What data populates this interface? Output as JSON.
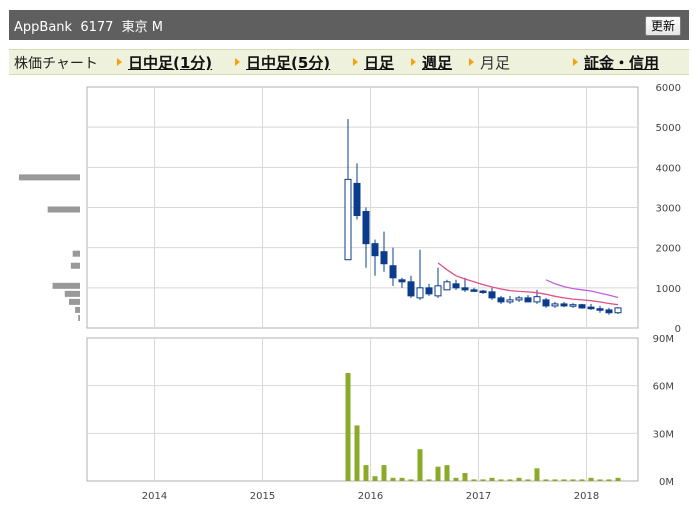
{
  "header": {
    "title": "AppBank  6177  東京 M",
    "refresh_label": "更新"
  },
  "nav": {
    "label": "株価チャート",
    "items": [
      {
        "label": "日中足(1分)",
        "current": false
      },
      {
        "label": "日中足(5分)",
        "current": false
      },
      {
        "label": "日足",
        "current": false
      },
      {
        "label": "週足",
        "current": false
      },
      {
        "label": "月足",
        "current": true
      },
      {
        "label": "証金・信用",
        "current": false
      }
    ]
  },
  "chart_data": [
    {
      "type": "candlestick",
      "title": "",
      "x_tick_labels": [
        "2014",
        "2015",
        "2016",
        "2017",
        "2018"
      ],
      "y_tick_labels": [
        "0",
        "1000",
        "2000",
        "3000",
        "4000",
        "5000",
        "6000"
      ],
      "ylim": [
        0,
        6000
      ],
      "grid": true,
      "colors": {
        "up": "#ffffff",
        "up_border": "#0b3c8c",
        "down": "#0b3c8c",
        "ma1": "#e0508a",
        "ma2": "#c060e0"
      },
      "candles": [
        {
          "date": "2015-10",
          "open": 1700,
          "high": 5200,
          "low": 1700,
          "close": 3700
        },
        {
          "date": "2015-11",
          "open": 3600,
          "high": 4100,
          "low": 2700,
          "close": 2800
        },
        {
          "date": "2015-12",
          "open": 2900,
          "high": 3000,
          "low": 1500,
          "close": 2100
        },
        {
          "date": "2016-01",
          "open": 2100,
          "high": 2200,
          "low": 1300,
          "close": 1800
        },
        {
          "date": "2016-02",
          "open": 1900,
          "high": 2400,
          "low": 1400,
          "close": 1600
        },
        {
          "date": "2016-03",
          "open": 1550,
          "high": 2000,
          "low": 1050,
          "close": 1250
        },
        {
          "date": "2016-04",
          "open": 1200,
          "high": 1250,
          "low": 1000,
          "close": 1150
        },
        {
          "date": "2016-05",
          "open": 1150,
          "high": 1300,
          "low": 750,
          "close": 800
        },
        {
          "date": "2016-06",
          "open": 750,
          "high": 1950,
          "low": 700,
          "close": 1000
        },
        {
          "date": "2016-07",
          "open": 1000,
          "high": 1100,
          "low": 800,
          "close": 850
        },
        {
          "date": "2016-08",
          "open": 800,
          "high": 1500,
          "low": 750,
          "close": 1050
        },
        {
          "date": "2016-09",
          "open": 950,
          "high": 1200,
          "low": 950,
          "close": 1150
        },
        {
          "date": "2016-10",
          "open": 1100,
          "high": 1200,
          "low": 950,
          "close": 1000
        },
        {
          "date": "2016-11",
          "open": 1000,
          "high": 1250,
          "low": 900,
          "close": 950
        },
        {
          "date": "2016-12",
          "open": 950,
          "high": 1000,
          "low": 900,
          "close": 920
        },
        {
          "date": "2017-01",
          "open": 920,
          "high": 950,
          "low": 850,
          "close": 900
        },
        {
          "date": "2017-02",
          "open": 900,
          "high": 1000,
          "low": 700,
          "close": 750
        },
        {
          "date": "2017-03",
          "open": 750,
          "high": 800,
          "low": 600,
          "close": 650
        },
        {
          "date": "2017-04",
          "open": 650,
          "high": 800,
          "low": 600,
          "close": 700
        },
        {
          "date": "2017-05",
          "open": 700,
          "high": 800,
          "low": 650,
          "close": 750
        },
        {
          "date": "2017-06",
          "open": 750,
          "high": 820,
          "low": 650,
          "close": 650
        },
        {
          "date": "2017-07",
          "open": 650,
          "high": 950,
          "low": 600,
          "close": 780
        },
        {
          "date": "2017-08",
          "open": 700,
          "high": 750,
          "low": 500,
          "close": 550
        },
        {
          "date": "2017-09",
          "open": 550,
          "high": 650,
          "low": 500,
          "close": 600
        },
        {
          "date": "2017-10",
          "open": 600,
          "high": 650,
          "low": 520,
          "close": 550
        },
        {
          "date": "2017-11",
          "open": 560,
          "high": 620,
          "low": 500,
          "close": 580
        },
        {
          "date": "2017-12",
          "open": 580,
          "high": 600,
          "low": 480,
          "close": 500
        },
        {
          "date": "2018-01",
          "open": 520,
          "high": 600,
          "low": 450,
          "close": 480
        },
        {
          "date": "2018-02",
          "open": 480,
          "high": 550,
          "low": 380,
          "close": 450
        },
        {
          "date": "2018-03",
          "open": 450,
          "high": 500,
          "low": 330,
          "close": 380
        },
        {
          "date": "2018-04",
          "open": 380,
          "high": 520,
          "low": 350,
          "close": 500
        }
      ],
      "ma1": [
        {
          "date": "2016-08",
          "value": 1620
        },
        {
          "date": "2016-09",
          "value": 1450
        },
        {
          "date": "2016-10",
          "value": 1300
        },
        {
          "date": "2016-11",
          "value": 1220
        },
        {
          "date": "2016-12",
          "value": 1150
        },
        {
          "date": "2017-01",
          "value": 1080
        },
        {
          "date": "2017-02",
          "value": 1020
        },
        {
          "date": "2017-03",
          "value": 970
        },
        {
          "date": "2017-04",
          "value": 930
        },
        {
          "date": "2017-05",
          "value": 910
        },
        {
          "date": "2017-06",
          "value": 900
        },
        {
          "date": "2017-07",
          "value": 880
        },
        {
          "date": "2017-08",
          "value": 840
        },
        {
          "date": "2017-09",
          "value": 790
        },
        {
          "date": "2017-10",
          "value": 750
        },
        {
          "date": "2017-11",
          "value": 720
        },
        {
          "date": "2017-12",
          "value": 700
        },
        {
          "date": "2018-01",
          "value": 680
        },
        {
          "date": "2018-02",
          "value": 650
        },
        {
          "date": "2018-03",
          "value": 610
        },
        {
          "date": "2018-04",
          "value": 580
        }
      ],
      "ma2": [
        {
          "date": "2017-08",
          "value": 1200
        },
        {
          "date": "2017-09",
          "value": 1100
        },
        {
          "date": "2017-10",
          "value": 1030
        },
        {
          "date": "2017-11",
          "value": 980
        },
        {
          "date": "2017-12",
          "value": 950
        },
        {
          "date": "2018-01",
          "value": 920
        },
        {
          "date": "2018-02",
          "value": 870
        },
        {
          "date": "2018-03",
          "value": 820
        },
        {
          "date": "2018-04",
          "value": 760
        }
      ],
      "price_volume_profile": [
        {
          "price": 3750,
          "amount": 1.0
        },
        {
          "price": 2950,
          "amount": 0.53
        },
        {
          "price": 1850,
          "amount": 0.12
        },
        {
          "price": 1550,
          "amount": 0.15
        },
        {
          "price": 1050,
          "amount": 0.45
        },
        {
          "price": 850,
          "amount": 0.25
        },
        {
          "price": 650,
          "amount": 0.18
        },
        {
          "price": 450,
          "amount": 0.08
        },
        {
          "price": 250,
          "amount": 0.03
        }
      ]
    },
    {
      "type": "bar",
      "title": "",
      "y_tick_labels": [
        "0M",
        "30M",
        "60M",
        "90M"
      ],
      "ylim": [
        0,
        90
      ],
      "grid": true,
      "bar_color": "#8aab2a",
      "volume": [
        {
          "date": "2015-10",
          "value": 68
        },
        {
          "date": "2015-11",
          "value": 35
        },
        {
          "date": "2015-12",
          "value": 10
        },
        {
          "date": "2016-01",
          "value": 3
        },
        {
          "date": "2016-02",
          "value": 10
        },
        {
          "date": "2016-03",
          "value": 2
        },
        {
          "date": "2016-04",
          "value": 2
        },
        {
          "date": "2016-05",
          "value": 1
        },
        {
          "date": "2016-06",
          "value": 20
        },
        {
          "date": "2016-07",
          "value": 1
        },
        {
          "date": "2016-08",
          "value": 9
        },
        {
          "date": "2016-09",
          "value": 10
        },
        {
          "date": "2016-10",
          "value": 2
        },
        {
          "date": "2016-11",
          "value": 5
        },
        {
          "date": "2016-12",
          "value": 1
        },
        {
          "date": "2017-01",
          "value": 1
        },
        {
          "date": "2017-02",
          "value": 2
        },
        {
          "date": "2017-03",
          "value": 1
        },
        {
          "date": "2017-04",
          "value": 1
        },
        {
          "date": "2017-05",
          "value": 2
        },
        {
          "date": "2017-06",
          "value": 1
        },
        {
          "date": "2017-07",
          "value": 8
        },
        {
          "date": "2017-08",
          "value": 1
        },
        {
          "date": "2017-09",
          "value": 1
        },
        {
          "date": "2017-10",
          "value": 1
        },
        {
          "date": "2017-11",
          "value": 1
        },
        {
          "date": "2017-12",
          "value": 1
        },
        {
          "date": "2018-01",
          "value": 2
        },
        {
          "date": "2018-02",
          "value": 1
        },
        {
          "date": "2018-03",
          "value": 1
        },
        {
          "date": "2018-04",
          "value": 2
        }
      ]
    }
  ]
}
